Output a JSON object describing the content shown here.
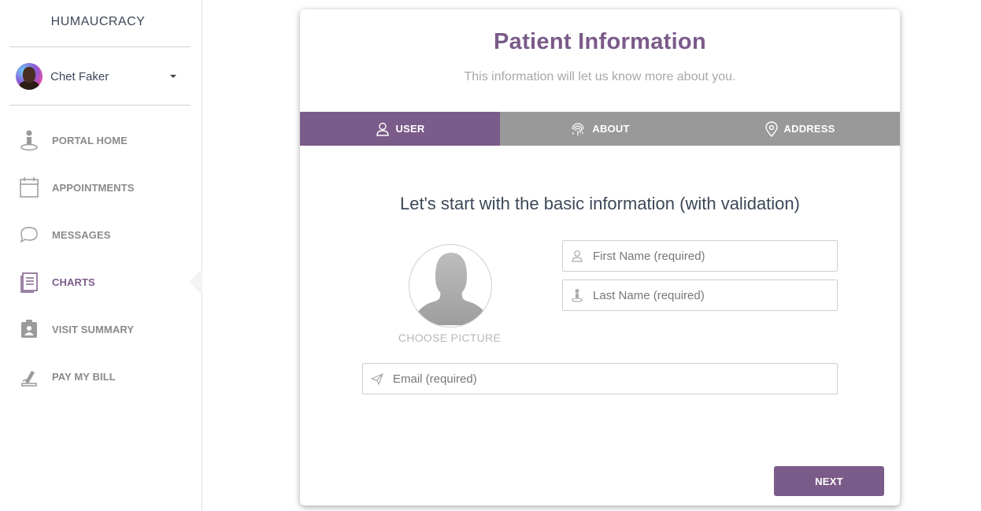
{
  "sidebar": {
    "brand": "HUMAUCRACY",
    "user": {
      "name": "Chet Faker"
    },
    "items": [
      {
        "label": "PORTAL HOME",
        "icon": "person-pin-icon",
        "active": false
      },
      {
        "label": "APPOINTMENTS",
        "icon": "calendar-icon",
        "active": false
      },
      {
        "label": "MESSAGES",
        "icon": "chat-bubbles-icon",
        "active": false
      },
      {
        "label": "CHARTS",
        "icon": "document-icon",
        "active": true
      },
      {
        "label": "VISIT SUMMARY",
        "icon": "badge-icon",
        "active": false
      },
      {
        "label": "PAY MY BILL",
        "icon": "signing-hand-icon",
        "active": false
      }
    ]
  },
  "card": {
    "title": "Patient Information",
    "subtitle": "This information will let us know more about you.",
    "tabs": [
      {
        "label": "USER",
        "icon": "user-icon",
        "active": true
      },
      {
        "label": "ABOUT",
        "icon": "fingerprint-icon",
        "active": false
      },
      {
        "label": "ADDRESS",
        "icon": "location-pin-icon",
        "active": false
      }
    ],
    "lead": "Let's start with the basic information (with validation)",
    "choose_picture": "CHOOSE PICTURE",
    "fields": {
      "first_name": {
        "placeholder": "First Name (required)",
        "value": ""
      },
      "last_name": {
        "placeholder": "Last Name (required)",
        "value": ""
      },
      "email": {
        "placeholder": "Email (required)",
        "value": ""
      }
    },
    "next_label": "NEXT"
  },
  "colors": {
    "accent": "#7b5b89",
    "tab_inactive": "#999999",
    "nav_text": "#8a8a8a"
  }
}
